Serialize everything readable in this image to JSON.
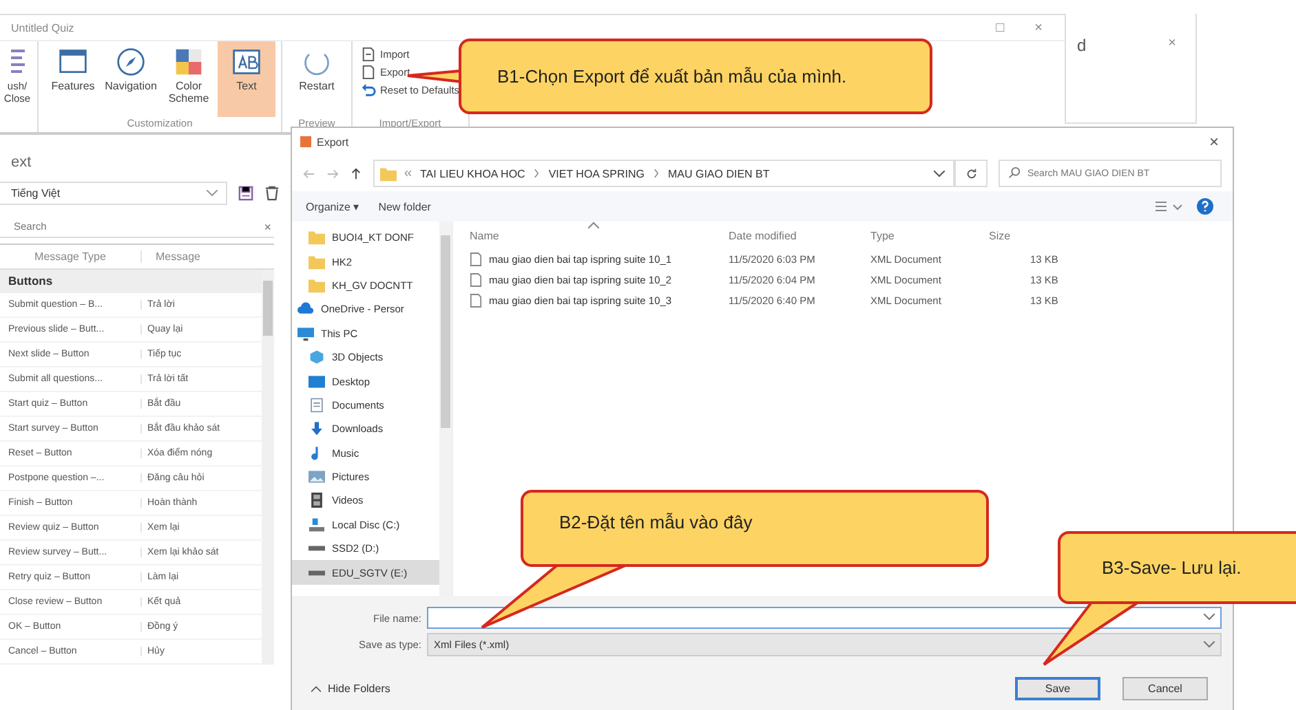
{
  "main_window": {
    "title": "Untitled Quiz",
    "maximize_glyph": "□",
    "close_glyph": "×"
  },
  "back_window": {
    "title_fragment": "d",
    "close_glyph": "×"
  },
  "ribbon": {
    "leading_item": {
      "label": "ush/ Close"
    },
    "groups": [
      {
        "label": "Customization",
        "items": [
          {
            "label": "Features",
            "kind": "large",
            "selected": false
          },
          {
            "label": "Navigation",
            "kind": "large",
            "selected": false
          },
          {
            "label": "Color Scheme",
            "kind": "large",
            "selected": false
          },
          {
            "label": "Text",
            "kind": "large",
            "selected": true
          }
        ]
      },
      {
        "label": "Preview",
        "items": [
          {
            "label": "Restart",
            "kind": "large",
            "selected": false
          }
        ]
      },
      {
        "label": "Import/Export",
        "items": [
          {
            "label": "Import",
            "kind": "small",
            "selected": false
          },
          {
            "label": "Export",
            "kind": "small",
            "selected": false
          },
          {
            "label": "Reset to Defaults",
            "kind": "small",
            "selected": false
          }
        ]
      }
    ]
  },
  "text_panel": {
    "title": "ext",
    "language": "Tiếng Việt",
    "search_placeholder": "Search",
    "clear_glyph": "×",
    "columns": [
      "Message Type",
      "Message"
    ],
    "group": "Buttons",
    "rows": [
      {
        "type": "Submit question – B...",
        "message": "Trả lời"
      },
      {
        "type": "Previous slide – Butt...",
        "message": "Quay lại"
      },
      {
        "type": "Next slide – Button",
        "message": "Tiếp tục"
      },
      {
        "type": "Submit all questions...",
        "message": "Trả lời tất"
      },
      {
        "type": "Start quiz – Button",
        "message": "Bắt đầu"
      },
      {
        "type": "Start survey – Button",
        "message": "Bắt đầu khảo sát"
      },
      {
        "type": "Reset – Button",
        "message": "Xóa điểm nóng"
      },
      {
        "type": "Postpone question –...",
        "message": "Đăng câu hỏi"
      },
      {
        "type": "Finish – Button",
        "message": "Hoàn thành"
      },
      {
        "type": "Review quiz – Button",
        "message": "Xem lại"
      },
      {
        "type": "Review survey – Butt...",
        "message": "Xem lại khảo sát"
      },
      {
        "type": "Retry quiz – Button",
        "message": "Làm lại"
      },
      {
        "type": "Close review – Button",
        "message": "Kết quả"
      },
      {
        "type": "OK – Button",
        "message": "Đồng ý"
      },
      {
        "type": "Cancel – Button",
        "message": "Hủy"
      }
    ]
  },
  "export_dialog": {
    "title": "Export",
    "close_glyph": "×",
    "breadcrumb": [
      "TAI LIEU KHOA HOC",
      "VIET HOA SPRING",
      "MAU GIAO DIEN BT"
    ],
    "search_placeholder": "Search MAU GIAO DIEN BT",
    "toolbar": {
      "organize": "Organize ▾",
      "new_folder": "New folder"
    },
    "nav_items": [
      {
        "label": "BUOI4_KT DONF",
        "kind": "folder",
        "selected": false
      },
      {
        "label": "HK2",
        "kind": "folder",
        "selected": false
      },
      {
        "label": "KH_GV DOCNTT",
        "kind": "folder",
        "selected": false
      },
      {
        "label": "OneDrive - Persor",
        "kind": "cloud",
        "selected": false
      },
      {
        "label": "This PC",
        "kind": "pc",
        "selected": false,
        "children": [
          {
            "label": "3D Objects",
            "kind": "cube",
            "selected": false
          },
          {
            "label": "Desktop",
            "kind": "desktop",
            "selected": false
          },
          {
            "label": "Documents",
            "kind": "document",
            "selected": false
          },
          {
            "label": "Downloads",
            "kind": "download",
            "selected": false
          },
          {
            "label": "Music",
            "kind": "music",
            "selected": false
          },
          {
            "label": "Pictures",
            "kind": "picture",
            "selected": false
          },
          {
            "label": "Videos",
            "kind": "video",
            "selected": false
          },
          {
            "label": "Local Disc (C:)",
            "kind": "disk",
            "selected": false
          },
          {
            "label": "SSD2 (D:)",
            "kind": "drive",
            "selected": false
          },
          {
            "label": "EDU_SGTV (E:)",
            "kind": "drive",
            "selected": true
          }
        ]
      }
    ],
    "columns": [
      "Name",
      "Date modified",
      "Type",
      "Size"
    ],
    "files": [
      {
        "name": "mau giao dien bai tap ispring suite 10_1",
        "date": "11/5/2020 6:03 PM",
        "type": "XML Document",
        "size": "13 KB"
      },
      {
        "name": "mau giao dien bai tap ispring suite 10_2",
        "date": "11/5/2020 6:04 PM",
        "type": "XML Document",
        "size": "13 KB"
      },
      {
        "name": "mau giao dien bai tap ispring suite 10_3",
        "date": "11/5/2020 6:40 PM",
        "type": "XML Document",
        "size": "13 KB"
      }
    ],
    "file_name": {
      "label": "File name:"
    },
    "save_as_type": {
      "label": "Save as type:",
      "value": "Xml Files (*.xml)"
    },
    "hide_folders": "Hide Folders",
    "buttons": [
      "Save",
      "Cancel"
    ]
  },
  "callouts": [
    "B1-Chọn Export để xuất bản mẫu của mình.",
    "B2-Đặt tên mẫu vào đây",
    "B3-Save- Lưu lại."
  ]
}
